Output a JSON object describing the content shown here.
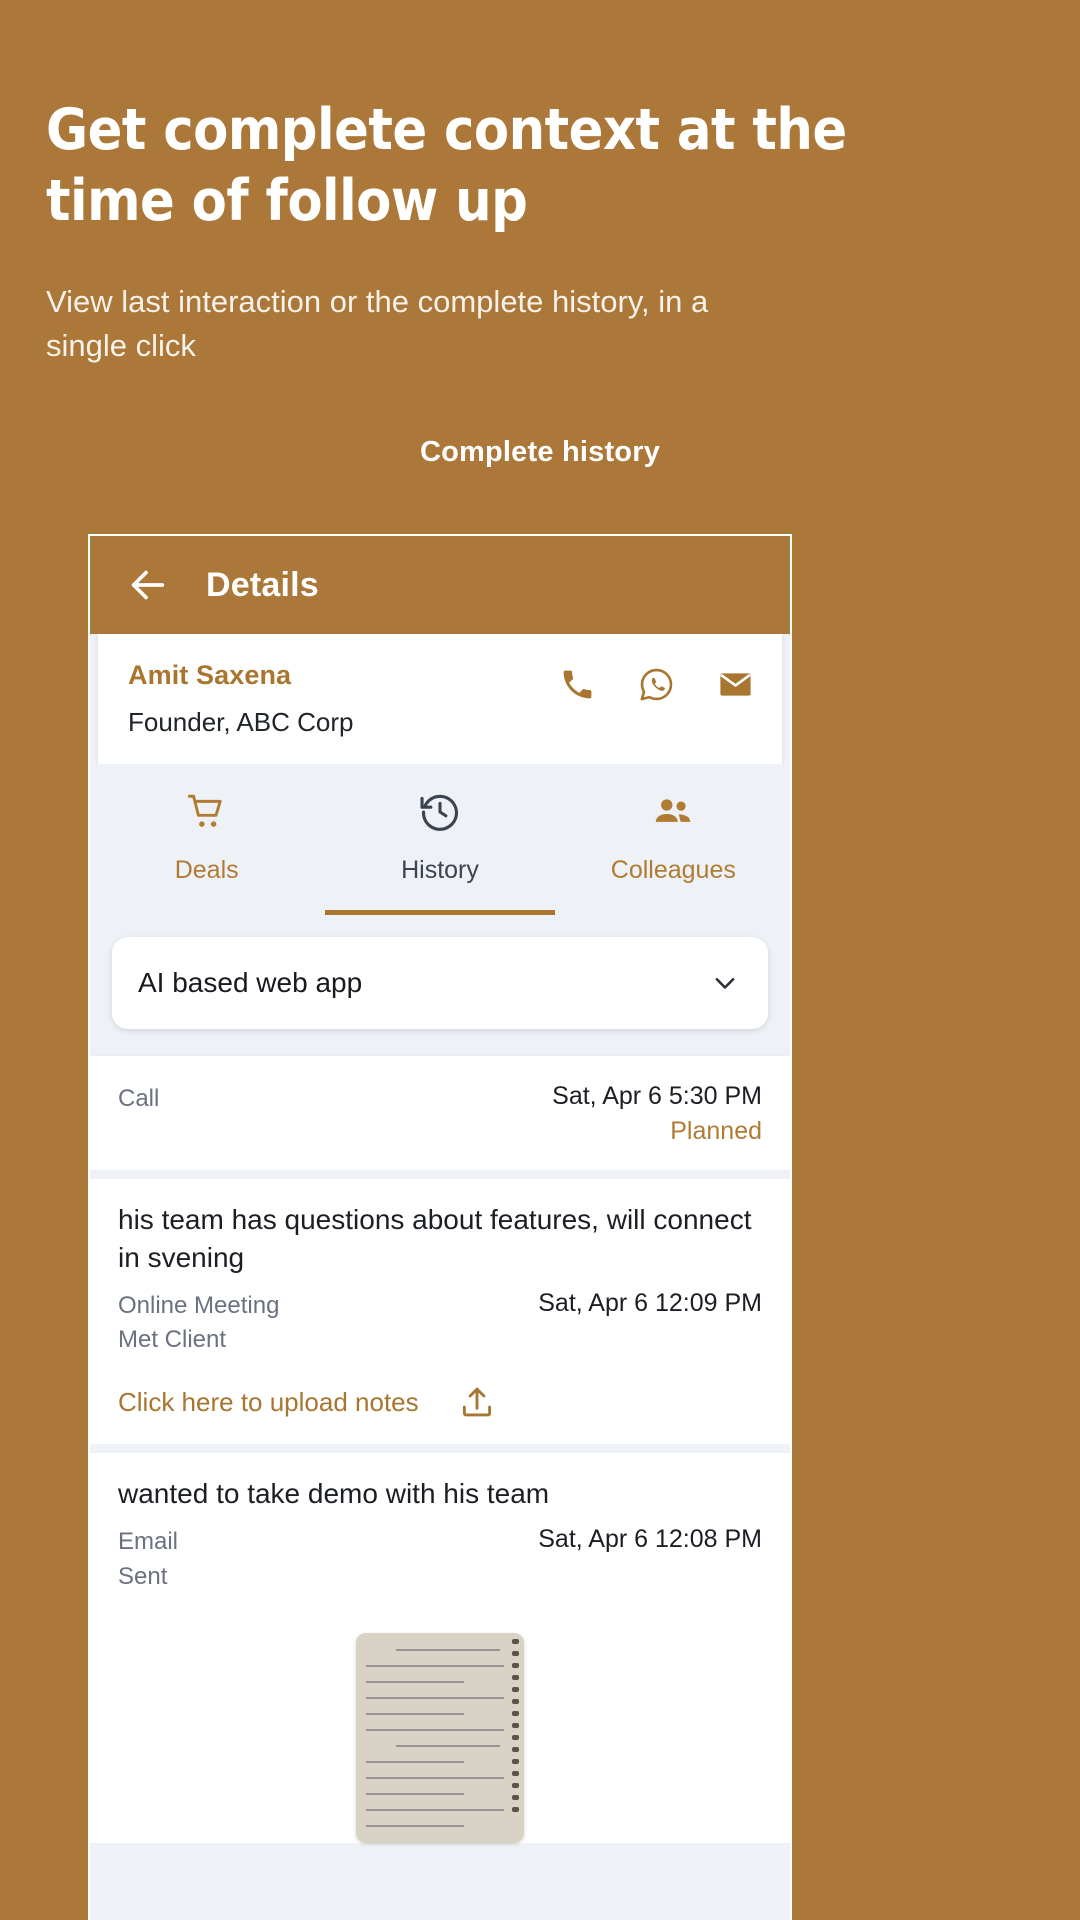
{
  "promo": {
    "title": "Get complete context at the time of follow up",
    "subtitle": "View last interaction or the complete history, in a single click",
    "section_label": "Complete history"
  },
  "theme": {
    "brand_brown": "#ab7839",
    "accent_brown": "#a9762f",
    "screen_bg": "#eef1f6",
    "card_bg": "#ffffff",
    "text_dark": "#1b1e24",
    "text_muted": "#6a7280"
  },
  "app": {
    "appbar": {
      "back_icon": "arrow-left-icon",
      "title": "Details"
    },
    "contact": {
      "name": "Amit Saxena",
      "role": "Founder, ABC Corp",
      "actions": [
        {
          "icon": "phone-icon",
          "label": "Call"
        },
        {
          "icon": "whatsapp-icon",
          "label": "WhatsApp"
        },
        {
          "icon": "email-icon",
          "label": "Email"
        }
      ]
    },
    "tabs": [
      {
        "label": "Deals",
        "icon": "shopping-cart-icon",
        "active": false
      },
      {
        "label": "History",
        "icon": "history-clock-icon",
        "active": true
      },
      {
        "label": "Colleagues",
        "icon": "people-icon",
        "active": false
      }
    ],
    "deal_selector": {
      "value": "AI based web app",
      "icon": "chevron-down-icon"
    },
    "history": [
      {
        "note": "",
        "type": "Call",
        "sub": "",
        "date": "Sat, Apr 6 5:30 PM",
        "status": "Planned",
        "upload_label": "",
        "upload_icon": ""
      },
      {
        "note": "his team has questions about features, will connect in svening",
        "type": "Online Meeting",
        "sub": "Met Client",
        "date": "Sat, Apr 6 12:09 PM",
        "status": "",
        "upload_label": "Click here to upload notes",
        "upload_icon": "upload-icon"
      },
      {
        "note": "wanted to take demo with his team",
        "type": "Email",
        "sub": "Sent",
        "date": "Sat, Apr 6 12:08 PM",
        "status": "",
        "upload_label": "",
        "upload_icon": "",
        "attachment": "handwritten-note-thumbnail"
      }
    ]
  }
}
